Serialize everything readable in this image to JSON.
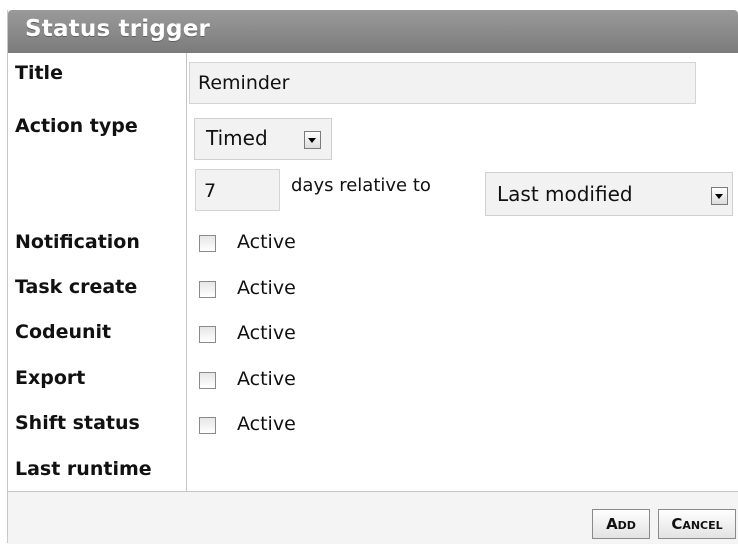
{
  "dialog": {
    "title": "Status trigger"
  },
  "fields": {
    "title_label": "Title",
    "title_value": "Reminder",
    "action_type_label": "Action type",
    "action_type_value": "Timed",
    "days_value": "7",
    "days_relative_text": "days relative to",
    "relative_to_value": "Last modified",
    "last_runtime_label": "Last runtime"
  },
  "triggers": [
    {
      "label": "Notification",
      "checkbox_label": "Active",
      "checked": false
    },
    {
      "label": "Task create",
      "checkbox_label": "Active",
      "checked": false
    },
    {
      "label": "Codeunit",
      "checkbox_label": "Active",
      "checked": false
    },
    {
      "label": "Export",
      "checkbox_label": "Active",
      "checked": false
    },
    {
      "label": "Shift status",
      "checkbox_label": "Active",
      "checked": false
    }
  ],
  "footer": {
    "add_label": "Add",
    "cancel_label": "Cancel"
  }
}
